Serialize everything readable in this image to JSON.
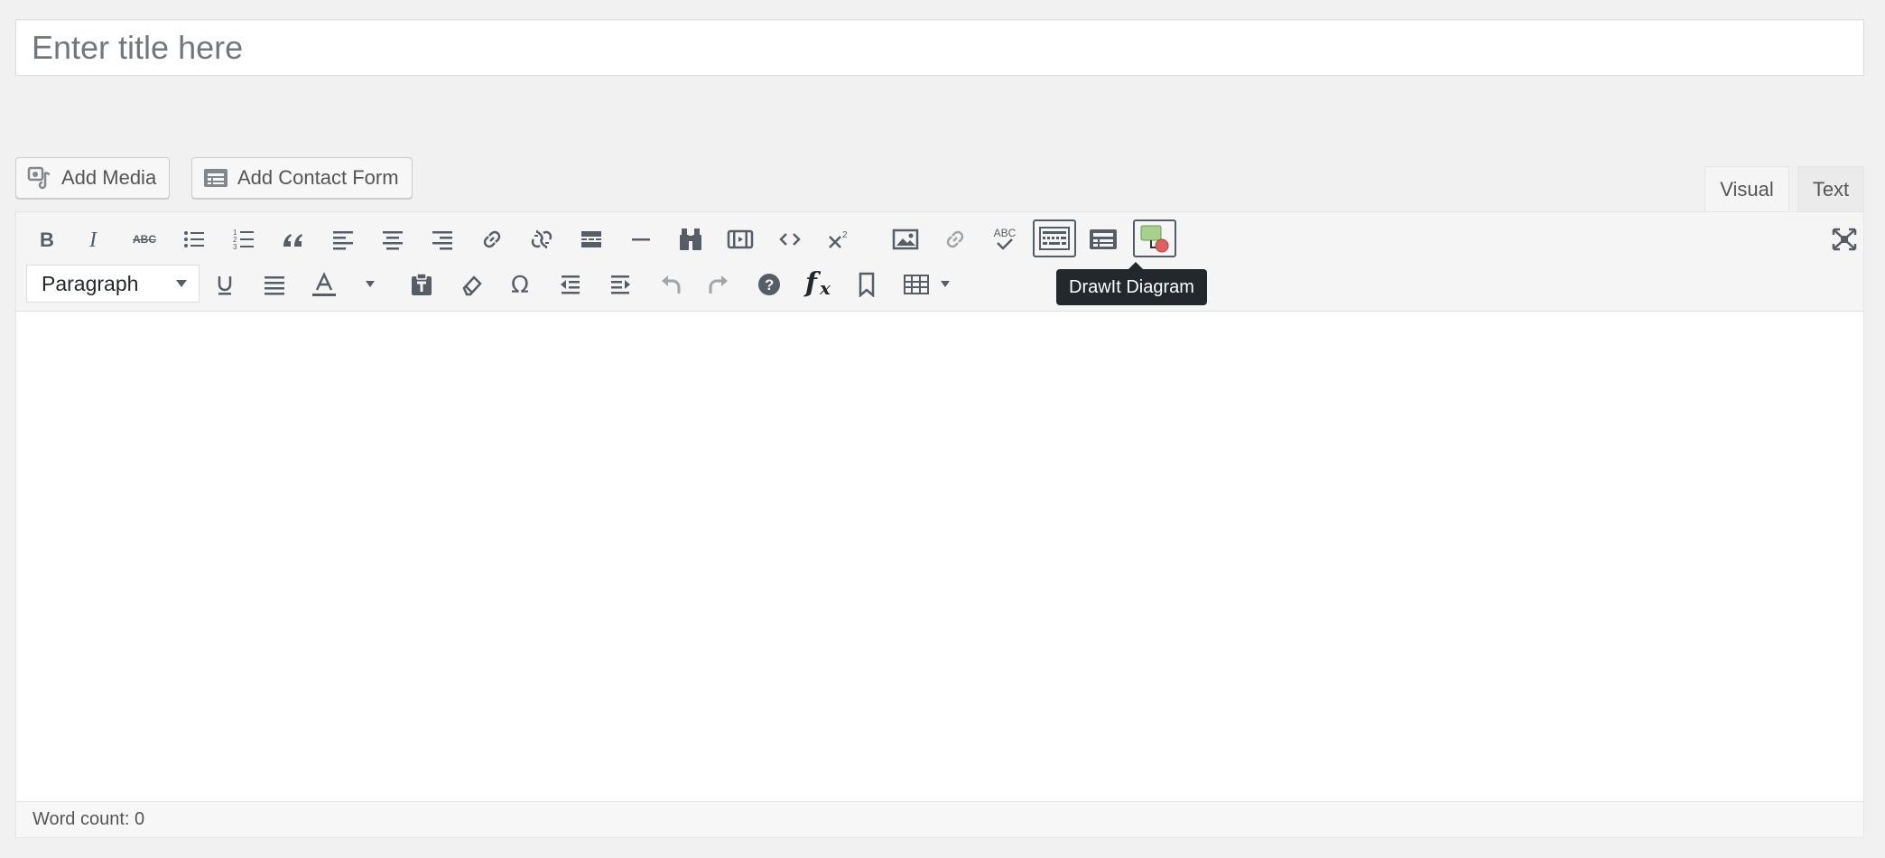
{
  "title_field": {
    "placeholder": "Enter title here",
    "value": ""
  },
  "media_buttons": {
    "add_media": "Add Media",
    "add_contact_form": "Add Contact Form"
  },
  "editor_tabs": {
    "visual": "Visual",
    "text": "Text",
    "active": "visual"
  },
  "toolbar": {
    "format_select": "Paragraph",
    "strikethrough_label": "ABC",
    "spellcheck_label": "ABC",
    "tooltip": "DrawIt Diagram"
  },
  "status_bar": {
    "word_count": "Word count: 0"
  },
  "colors": {
    "background": "#f1f1f1",
    "toolbar": "#f5f5f5",
    "icon": "#555d66",
    "tooltip": "#23282d"
  }
}
